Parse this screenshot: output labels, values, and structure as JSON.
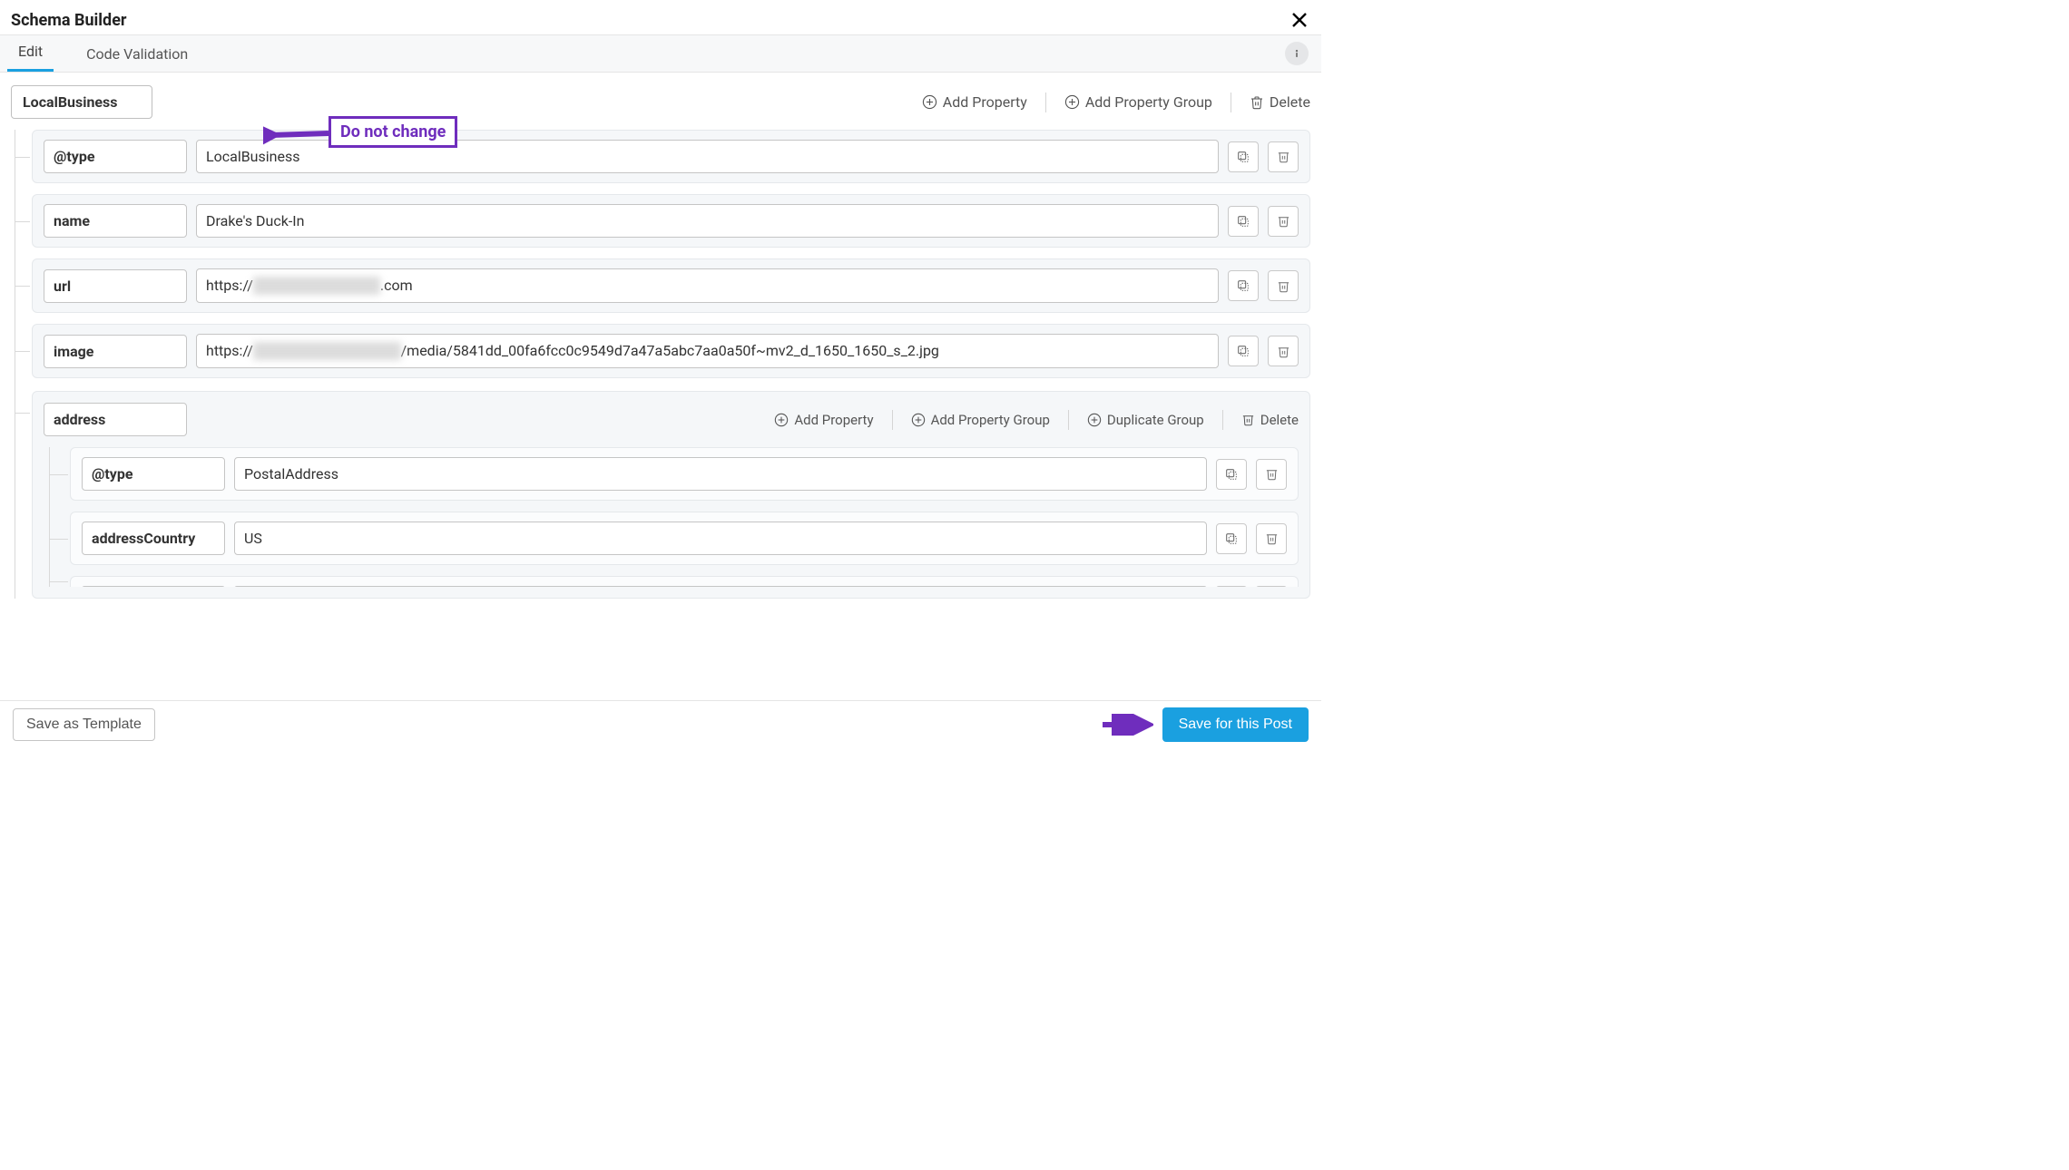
{
  "header": {
    "title": "Schema Builder"
  },
  "tabs": {
    "edit": "Edit",
    "code_validation": "Code Validation"
  },
  "top_actions": {
    "add_property": "Add Property",
    "add_property_group": "Add Property Group",
    "delete": "Delete"
  },
  "schema": {
    "root_type": "LocalBusiness",
    "rows": [
      {
        "key": "@type",
        "value": "LocalBusiness"
      },
      {
        "key": "name",
        "value": "Drake's Duck-In"
      },
      {
        "key": "url",
        "value_pre": "https://",
        "value_blur": "████████████",
        "value_post": ".com"
      },
      {
        "key": "image",
        "value_pre": "https://",
        "value_blur": "██████████████",
        "value_post": "/media/5841dd_00fa6fcc0c9549d7a47a5abc7aa0a50f~mv2_d_1650_1650_s_2.jpg"
      }
    ],
    "group": {
      "key": "address",
      "actions": {
        "add_property": "Add Property",
        "add_property_group": "Add Property Group",
        "duplicate_group": "Duplicate Group",
        "delete": "Delete"
      },
      "rows": [
        {
          "key": "@type",
          "value": "PostalAddress"
        },
        {
          "key": "addressCountry",
          "value": "US"
        }
      ]
    }
  },
  "annotation": {
    "do_not_change": "Do not change"
  },
  "footer": {
    "save_template": "Save as Template",
    "save_post": "Save for this Post"
  }
}
